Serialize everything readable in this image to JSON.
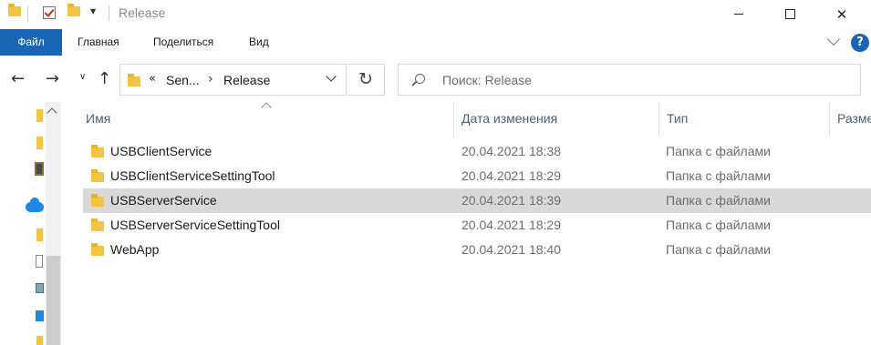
{
  "window": {
    "title": "Release"
  },
  "ribbon": {
    "tabs": [
      "Файл",
      "Главная",
      "Поделиться",
      "Вид"
    ]
  },
  "address": {
    "overflow": "«",
    "segments": [
      "Sen...",
      "Release"
    ]
  },
  "search": {
    "placeholder": "Поиск: Release"
  },
  "columns": {
    "name": "Имя",
    "date": "Дата изменения",
    "type": "Тип",
    "size": "Разме"
  },
  "files": [
    {
      "name": "USBClientService",
      "date": "20.04.2021 18:38",
      "type": "Папка с файлами",
      "selected": false
    },
    {
      "name": "USBClientServiceSettingTool",
      "date": "20.04.2021 18:29",
      "type": "Папка с файлами",
      "selected": false
    },
    {
      "name": "USBServerService",
      "date": "20.04.2021 18:39",
      "type": "Папка с файлами",
      "selected": true
    },
    {
      "name": "USBServerServiceSettingTool",
      "date": "20.04.2021 18:29",
      "type": "Папка с файлами",
      "selected": false
    },
    {
      "name": "WebApp",
      "date": "20.04.2021 18:40",
      "type": "Папка с файлами",
      "selected": false
    }
  ],
  "icons": {
    "help": "?",
    "close": "✕",
    "refresh": "↻"
  },
  "colors": {
    "accent": "#1a66b5",
    "selection": "#d9d9d9",
    "folder": "#f3c443"
  }
}
